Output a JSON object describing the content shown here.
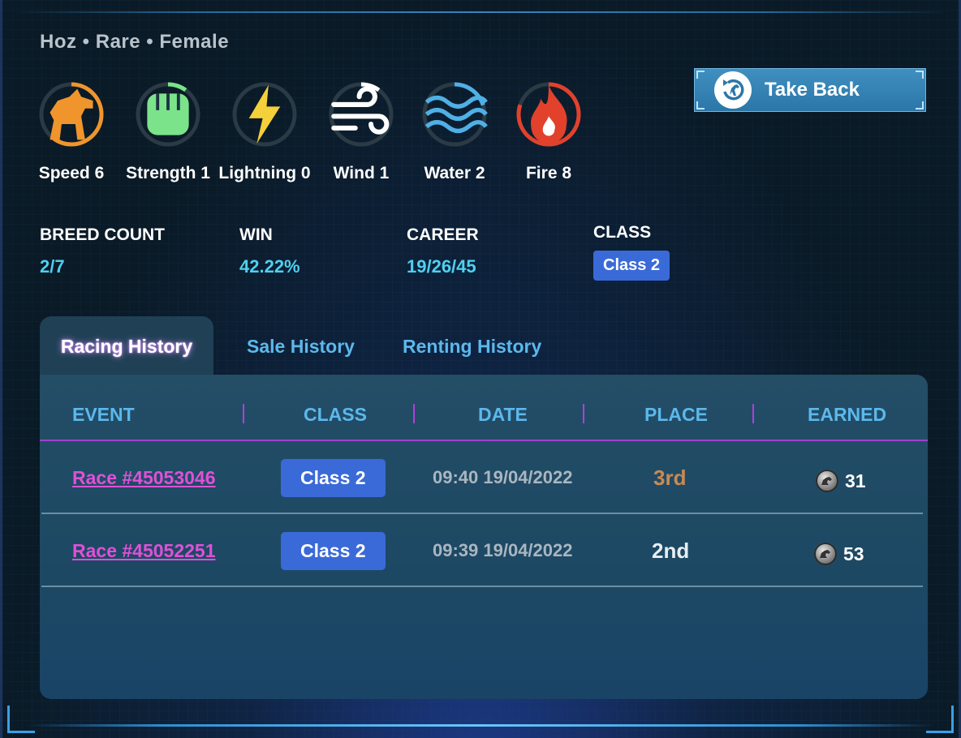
{
  "header": {
    "subtitle": "Hoz • Rare • Female",
    "take_back_label": "Take Back"
  },
  "stats": [
    {
      "label": "Speed  6",
      "icon": "horse-icon",
      "color": "#f0952c",
      "fill": 0.6
    },
    {
      "label": "Strength  1",
      "icon": "fist-icon",
      "color": "#7be38a",
      "fill": 0.1
    },
    {
      "label": "Lightning  0",
      "icon": "lightning-icon",
      "color": "#f4d03a",
      "fill": 0.0
    },
    {
      "label": "Wind  1",
      "icon": "wind-icon",
      "color": "#ffffff",
      "fill": 0.1
    },
    {
      "label": "Water  2",
      "icon": "water-icon",
      "color": "#4fb0e6",
      "fill": 0.2
    },
    {
      "label": "Fire  8",
      "icon": "fire-icon",
      "color": "#e2412b",
      "fill": 0.8
    }
  ],
  "info": {
    "breed_count_label": "BREED COUNT",
    "breed_count_value": "2/7",
    "win_label": "WIN",
    "win_value": "42.22%",
    "career_label": "CAREER",
    "career_value": "19/26/45",
    "class_label": "CLASS",
    "class_value": "Class 2"
  },
  "tabs": [
    {
      "label": "Racing History",
      "active": true
    },
    {
      "label": "Sale History",
      "active": false
    },
    {
      "label": "Renting History",
      "active": false
    }
  ],
  "table": {
    "headers": [
      "EVENT",
      "CLASS",
      "DATE",
      "PLACE",
      "EARNED"
    ],
    "rows": [
      {
        "event": "Race #45053046",
        "class": "Class 2",
        "date": "09:40 19/04/2022",
        "place": "3rd",
        "place_color": "#c98a52",
        "earned": "31"
      },
      {
        "event": "Race #45052251",
        "class": "Class 2",
        "date": "09:39 19/04/2022",
        "place": "2nd",
        "place_color": "#e8eef2",
        "earned": "53"
      }
    ]
  }
}
